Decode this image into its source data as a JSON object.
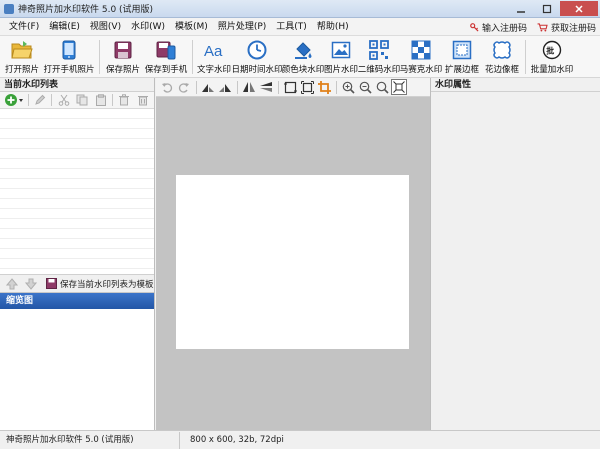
{
  "window": {
    "title": "神奇照片加水印软件 5.0 (试用版)"
  },
  "menu": {
    "items": [
      "文件(F)",
      "编辑(E)",
      "视图(V)",
      "水印(W)",
      "模板(M)",
      "照片处理(P)",
      "工具(T)",
      "帮助(H)"
    ],
    "register": "输入注册码",
    "buy": "获取注册码"
  },
  "toolbar": {
    "items": [
      {
        "label": "打开照片",
        "icon": "folder-open-icon"
      },
      {
        "label": "打开手机照片",
        "icon": "phone-icon"
      },
      {
        "label": "保存照片",
        "icon": "save-icon"
      },
      {
        "label": "保存到手机",
        "icon": "save-to-phone-icon"
      },
      {
        "label": "文字水印",
        "icon": "text-aa-icon"
      },
      {
        "label": "日期时间水印",
        "icon": "clock-icon"
      },
      {
        "label": "颜色块水印",
        "icon": "paint-bucket-icon"
      },
      {
        "label": "图片水印",
        "icon": "image-icon"
      },
      {
        "label": "二维码水印",
        "icon": "qrcode-icon"
      },
      {
        "label": "马赛克水印",
        "icon": "mosaic-icon"
      },
      {
        "label": "扩展边框",
        "icon": "border-expand-icon"
      },
      {
        "label": "花边像框",
        "icon": "lace-frame-icon"
      },
      {
        "label": "批量加水印",
        "icon": "batch-icon"
      }
    ]
  },
  "left_panel": {
    "watermark_list_title": "当前水印列表",
    "save_template": "保存当前水印列表为模板",
    "thumbnail_title": "缩览图"
  },
  "right_panel": {
    "title": "水印属性"
  },
  "statusbar": {
    "app": "神奇照片加水印软件 5.0 (试用版)",
    "image_info": "800 x 600, 32b, 72dpi"
  },
  "colors": {
    "accent": "#2356a6",
    "canvas_bg": "#c3c3c3"
  }
}
